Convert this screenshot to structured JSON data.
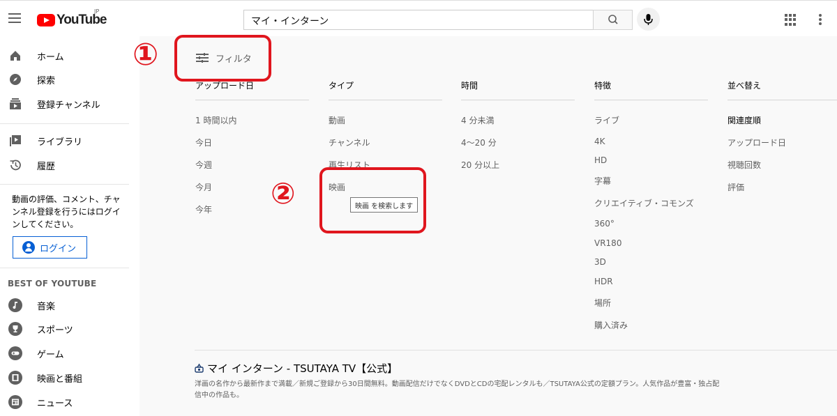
{
  "header": {
    "logo_text": "YouTube",
    "region": "JP",
    "search_value": "マイ・インターン"
  },
  "sidebar": {
    "primary": [
      {
        "label": "ホーム",
        "icon": "home-icon"
      },
      {
        "label": "探索",
        "icon": "compass-icon"
      },
      {
        "label": "登録チャンネル",
        "icon": "subscriptions-icon"
      }
    ],
    "secondary": [
      {
        "label": "ライブラリ",
        "icon": "library-icon"
      },
      {
        "label": "履歴",
        "icon": "history-icon"
      }
    ],
    "login_message": "動画の評価、コメント、チャンネル登録を行うにはログインしてください。",
    "login_button": "ログイン",
    "best_title": "BEST OF YOUTUBE",
    "best": [
      {
        "label": "音楽",
        "icon": "music-icon"
      },
      {
        "label": "スポーツ",
        "icon": "trophy-icon"
      },
      {
        "label": "ゲーム",
        "icon": "gamepad-icon"
      },
      {
        "label": "映画と番組",
        "icon": "film-icon"
      },
      {
        "label": "ニュース",
        "icon": "news-icon"
      }
    ]
  },
  "filter": {
    "toggle_label": "フィルタ",
    "columns": [
      {
        "title": "アップロード日",
        "options": [
          "1 時間以内",
          "今日",
          "今週",
          "今月",
          "今年"
        ]
      },
      {
        "title": "タイプ",
        "options": [
          "動画",
          "チャンネル",
          "再生リスト",
          "映画"
        ]
      },
      {
        "title": "時間",
        "options": [
          "4 分未満",
          "4～20 分",
          "20 分以上"
        ]
      },
      {
        "title": "特徴",
        "options": [
          "ライブ",
          "4K",
          "HD",
          "字幕",
          "クリエイティブ・コモンズ",
          "360°",
          "VR180",
          "3D",
          "HDR",
          "場所",
          "購入済み"
        ]
      },
      {
        "title": "並べ替え",
        "options": [
          "関連度順",
          "アップロード日",
          "視聴回数",
          "評価"
        ]
      }
    ],
    "tooltip": "映画 を検索します"
  },
  "result": {
    "title": "マイ インターン - TSUTAYA TV【公式】",
    "description": "洋画の名作から最新作まで満載／新規ご登録から30日間無料。動画配信だけでなくDVDとCDの宅配レンタルも／TSUTAYA公式の定額プラン。人気作品が豊富・独占配信中の作品も。"
  },
  "annotations": {
    "one": "①",
    "two": "②",
    "color": "#e0161e"
  }
}
